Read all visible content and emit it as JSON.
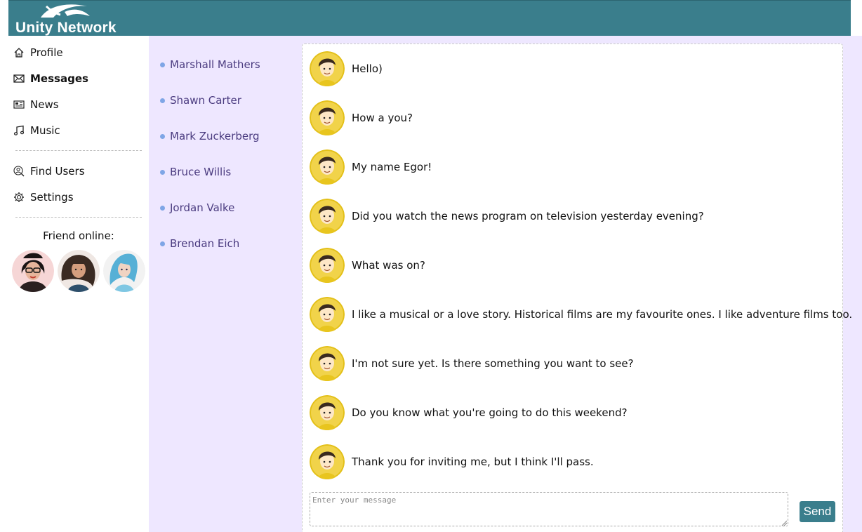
{
  "header": {
    "logo_text": "Unity Network"
  },
  "sidebar": {
    "items": [
      {
        "label": "Profile",
        "icon": "home-icon"
      },
      {
        "label": "Messages",
        "icon": "envelope-icon"
      },
      {
        "label": "News",
        "icon": "newspaper-icon"
      },
      {
        "label": "Music",
        "icon": "music-note-icon"
      },
      {
        "label": "Find Users",
        "icon": "user-search-icon"
      },
      {
        "label": "Settings",
        "icon": "gear-icon"
      }
    ],
    "friends_title": "Friend online:"
  },
  "dialogs": [
    "Marshall Mathers",
    "Shawn Carter",
    "Mark Zuckerberg",
    "Bruce Willis",
    "Jordan Valke",
    "Brendan Eich"
  ],
  "messages": [
    "Hello)",
    "How a you?",
    "My name Egor!",
    "Did you watch the news program on television yesterday evening?",
    "What was on?",
    "I like a musical or a love story. Historical films are my favourite ones. I like adventure films too.",
    "I'm not sure yet. Is there something you want to see?",
    "Do you know what you're going to do this weekend?",
    "Thank you for inviting me, but I think I'll pass."
  ],
  "composer": {
    "placeholder": "Enter your message",
    "send_label": "Send"
  },
  "colors": {
    "header": "#3a7e8c",
    "dialogs_bg": "#eee7ff",
    "dialog_link": "#4b3c80",
    "dot": "#7fa6e6"
  }
}
